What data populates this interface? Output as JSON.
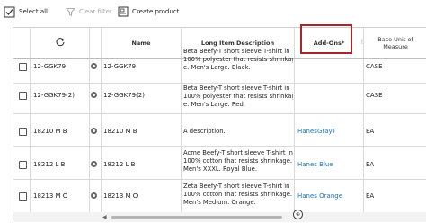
{
  "toolbar": {
    "select_all": "Select all",
    "clear_filter": "Clear filter",
    "create_product": "Create product"
  },
  "columns": {
    "name": "Name",
    "long_desc": "Long Item Description",
    "addons": "Add-Ons*",
    "base_unit": "Base Unit of Measure"
  },
  "rows": [
    {
      "id": "12-GGK79",
      "name": "12-GGK79",
      "desc1": "Beta Beefy-T short sleeve T-shirt in",
      "desc2": "100% polyester that resists shrinkag",
      "desc3": "e. Men's Large. Black.",
      "addon": "",
      "unit": "CASE"
    },
    {
      "id": "12-GGK79(2)",
      "name": "12-GGK79(2)",
      "desc1": "Beta Beefy-T short sleeve T-shirt in",
      "desc2": "100% polyester that resists shrinkag",
      "desc3": "e. Men's Large. Red.",
      "addon": "",
      "unit": "CASE"
    },
    {
      "id": "18210 M B",
      "name": "18210 M B",
      "desc1": "A description.",
      "desc2": "",
      "desc3": "",
      "addon": "HanesGrayT",
      "unit": "EA"
    },
    {
      "id": "18212 L B",
      "name": "18212 L B",
      "desc1": "Acme Beefy-T short sleeve T-shirt in",
      "desc2": "100% cotton that resists shrinkage.",
      "desc3": "Men's XXXL. Royal Blue.",
      "addon": "Hanes Blue",
      "unit": "EA"
    },
    {
      "id": "18213 M O",
      "name": "18213 M O",
      "desc1": "Zeta Beefy-T short sleeve T-shirt in",
      "desc2": "100% cotton that resists shrinkage.",
      "desc3": "Men's Medium. Orange.",
      "addon": "Hanes Orange",
      "unit": "EA"
    }
  ],
  "icons": {
    "select_all": "select-all-icon",
    "clear_filter": "filter-icon",
    "create_product": "create-product-icon",
    "refresh": "refresh-icon",
    "info": "info-icon"
  },
  "colors": {
    "link": "#1b75bb",
    "highlight": "#a4262c"
  }
}
